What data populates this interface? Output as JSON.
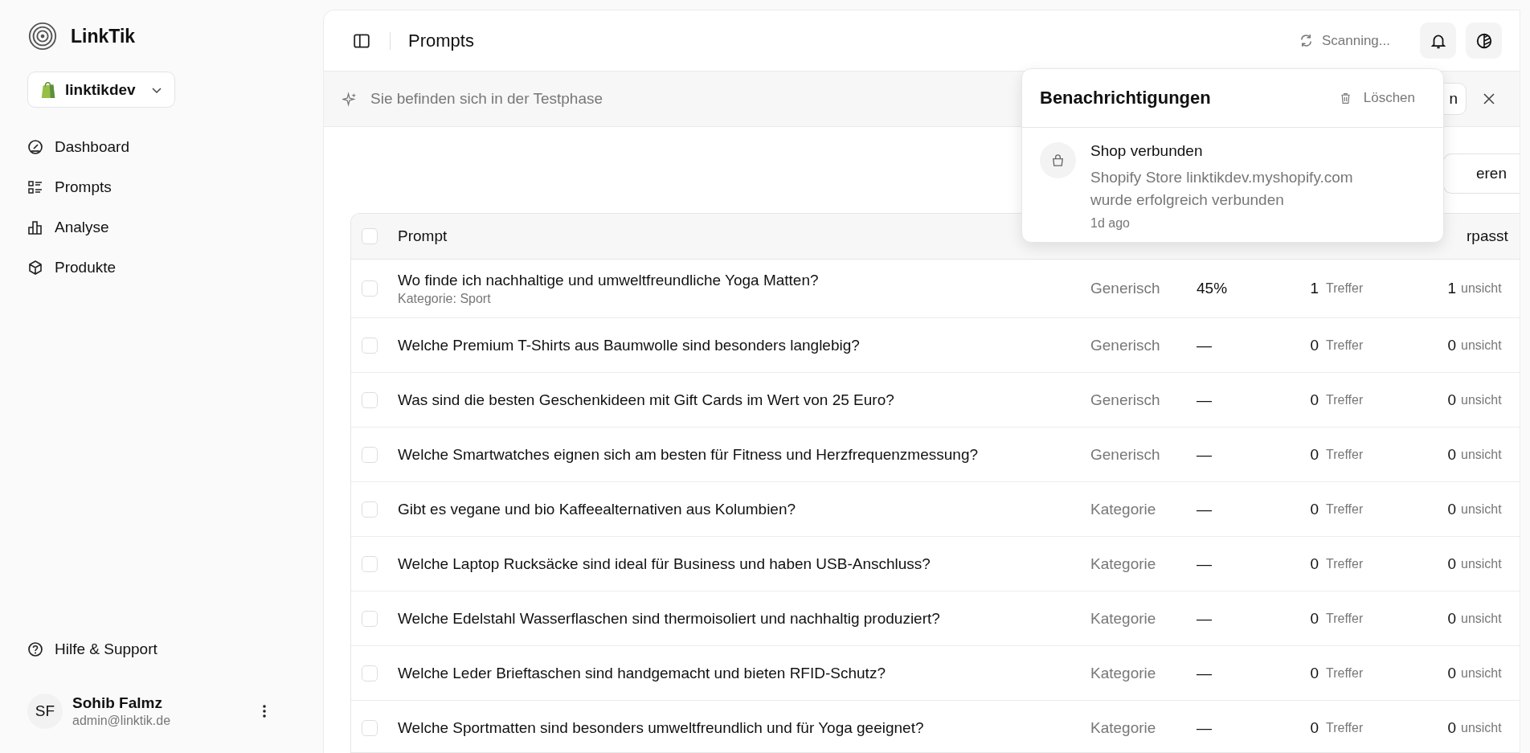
{
  "sidebar": {
    "brand": "LinkTik",
    "store": {
      "name": "linktikdev"
    },
    "nav": [
      {
        "label": "Dashboard",
        "kind": "gauge"
      },
      {
        "label": "Prompts",
        "kind": "list"
      },
      {
        "label": "Analyse",
        "kind": "chart"
      },
      {
        "label": "Produkte",
        "kind": "box"
      }
    ],
    "help": {
      "label": "Hilfe & Support"
    },
    "user": {
      "initials": "SF",
      "name": "Sohib Falmz",
      "email": "admin@linktik.de"
    }
  },
  "header": {
    "title": "Prompts",
    "status": "Scanning..."
  },
  "banner": {
    "text": "Sie befinden sich in der Testphase",
    "button": "n"
  },
  "toolbar": {
    "button": "eren"
  },
  "table": {
    "header_checked": false,
    "columns": [
      "Prompt",
      "rpasst"
    ],
    "rows": [
      {
        "checked": false,
        "prompt": "Wo finde ich nachhaltige und umweltfreundliche Yoga Matten?",
        "category": "Kategorie: Sport",
        "type": "Generisch",
        "score": "45%",
        "hits": "1",
        "hits_label": "Treffer",
        "missed": "1",
        "missed_label": "unsicht"
      },
      {
        "checked": false,
        "prompt": "Welche Premium T-Shirts aus Baumwolle sind besonders langlebig?",
        "type": "Generisch",
        "score": "—",
        "hits": "0",
        "hits_label": "Treffer",
        "missed": "0",
        "missed_label": "unsicht"
      },
      {
        "checked": false,
        "prompt": "Was sind die besten Geschenkideen mit Gift Cards im Wert von 25 Euro?",
        "type": "Generisch",
        "score": "—",
        "hits": "0",
        "hits_label": "Treffer",
        "missed": "0",
        "missed_label": "unsicht"
      },
      {
        "checked": false,
        "prompt": "Welche Smartwatches eignen sich am besten für Fitness und Herzfrequenzmessung?",
        "type": "Generisch",
        "score": "—",
        "hits": "0",
        "hits_label": "Treffer",
        "missed": "0",
        "missed_label": "unsicht"
      },
      {
        "checked": false,
        "prompt": "Gibt es vegane und bio Kaffeealternativen aus Kolumbien?",
        "type": "Kategorie",
        "score": "—",
        "hits": "0",
        "hits_label": "Treffer",
        "missed": "0",
        "missed_label": "unsicht"
      },
      {
        "checked": false,
        "prompt": "Welche Laptop Rucksäcke sind ideal für Business und haben USB-Anschluss?",
        "type": "Kategorie",
        "score": "—",
        "hits": "0",
        "hits_label": "Treffer",
        "missed": "0",
        "missed_label": "unsicht"
      },
      {
        "checked": false,
        "prompt": "Welche Edelstahl Wasserflaschen sind thermoisoliert und nachhaltig produziert?",
        "type": "Kategorie",
        "score": "—",
        "hits": "0",
        "hits_label": "Treffer",
        "missed": "0",
        "missed_label": "unsicht"
      },
      {
        "checked": false,
        "prompt": "Welche Leder Brieftaschen sind handgemacht und bieten RFID-Schutz?",
        "type": "Kategorie",
        "score": "—",
        "hits": "0",
        "hits_label": "Treffer",
        "missed": "0",
        "missed_label": "unsicht"
      },
      {
        "checked": false,
        "prompt": "Welche Sportmatten sind besonders umweltfreundlich und für Yoga geeignet?",
        "type": "Kategorie",
        "score": "—",
        "hits": "0",
        "hits_label": "Treffer",
        "missed": "0",
        "missed_label": "unsicht"
      }
    ]
  },
  "notifications": {
    "title": "Benachrichtigungen",
    "clear": "Löschen",
    "items": [
      {
        "title": "Shop verbunden",
        "text": "Shopify Store linktikdev.myshopify.com wurde erfolgreich verbunden",
        "time": "1d ago"
      }
    ]
  }
}
